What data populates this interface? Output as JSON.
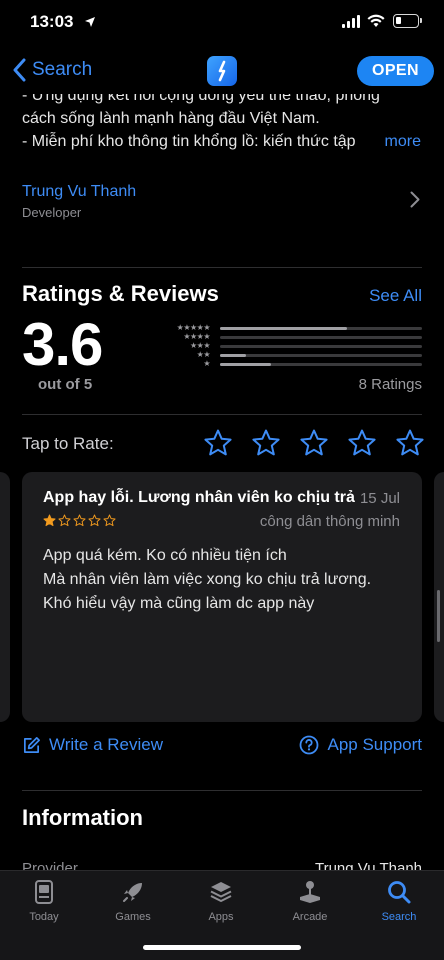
{
  "status_bar": {
    "time": "13:03"
  },
  "nav": {
    "back_label": "Search",
    "open_label": "OPEN"
  },
  "description": {
    "lines": [
      "- Ứng dụng kết nối cộng đồng yêu thể thao, phong",
      "cách sống lành mạnh hàng đầu Việt Nam.",
      "- Miễn phí kho thông tin khổng lồ: kiến thức tập"
    ],
    "more_label": "more"
  },
  "developer": {
    "name": "Trung Vu Thanh",
    "role": "Developer"
  },
  "ratings": {
    "title": "Ratings & Reviews",
    "see_all": "See All",
    "score": "3.6",
    "out_of": "out of 5",
    "count": "8 Ratings",
    "distribution": [
      {
        "stars": "★★★★★",
        "fraction": 0.63
      },
      {
        "stars": "★★★★",
        "fraction": 0.0
      },
      {
        "stars": "★★★",
        "fraction": 0.0
      },
      {
        "stars": "★★",
        "fraction": 0.13
      },
      {
        "stars": "★",
        "fraction": 0.25
      }
    ]
  },
  "tap_to_rate": {
    "label": "Tap to Rate:"
  },
  "review": {
    "title": "App hay lỗi. Lương nhân viên ko chịu trả",
    "date": "15 Jul",
    "author": "công dân thông minh",
    "rating": 1,
    "body_lines": [
      "App quá kém. Ko có nhiều tiện ích",
      "Mà nhân viên làm việc xong ko chịu trả lương.",
      "Khó hiểu vậy mà cũng làm dc app này"
    ]
  },
  "actions": {
    "write_review": "Write a Review",
    "app_support": "App Support"
  },
  "information": {
    "title": "Information",
    "provider_label": "Provider",
    "provider_value": "Trung Vu Thanh"
  },
  "tabs": [
    {
      "label": "Today",
      "icon": "today-icon"
    },
    {
      "label": "Games",
      "icon": "rocket-icon"
    },
    {
      "label": "Apps",
      "icon": "stack-icon"
    },
    {
      "label": "Arcade",
      "icon": "joystick-icon"
    },
    {
      "label": "Search",
      "icon": "search-icon",
      "active": true
    }
  ],
  "colors": {
    "accent": "#3e8cf5",
    "background": "#000000",
    "card": "#1c1c1e"
  }
}
